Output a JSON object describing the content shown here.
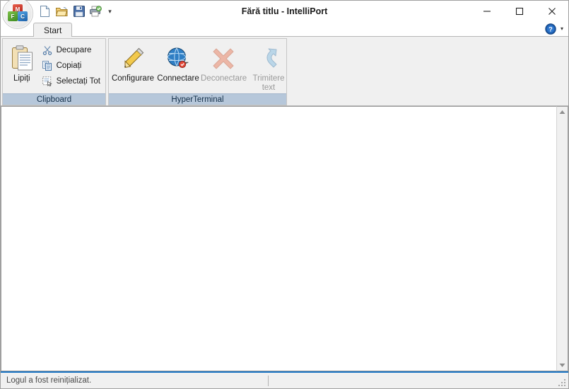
{
  "window": {
    "title": "Fără titlu - IntelliPort",
    "app_icon": "mfc-logo-icon",
    "cube_m": "M",
    "cube_f": "F",
    "cube_c": "C",
    "minimize_label": "—",
    "maximize_label": "▫",
    "close_label": "✕"
  },
  "quick_access": {
    "items": [
      {
        "name": "new-document-icon",
        "tooltip": "New"
      },
      {
        "name": "open-folder-icon",
        "tooltip": "Open"
      },
      {
        "name": "save-icon",
        "tooltip": "Save"
      },
      {
        "name": "print-icon",
        "tooltip": "Print"
      }
    ],
    "more_caret": "▾"
  },
  "ribbon": {
    "tabs": [
      {
        "label": "Start",
        "selected": true
      }
    ],
    "help": {
      "icon": "help-circle-icon",
      "glyph": "?",
      "caret": "▾"
    },
    "groups": [
      {
        "caption": "Clipboard",
        "big_button": {
          "label": "Lipiți",
          "icon": "paste-icon",
          "enabled": true
        },
        "small_buttons": [
          {
            "label": "Decupare",
            "icon": "cut-scissors-icon",
            "enabled": true
          },
          {
            "label": "Copiați",
            "icon": "copy-icon",
            "enabled": true
          },
          {
            "label": "Selectați Tot",
            "icon": "select-all-icon",
            "enabled": true
          }
        ]
      },
      {
        "caption": "HyperTerminal",
        "buttons": [
          {
            "label": "Configurare",
            "icon": "pencil-icon",
            "enabled": true
          },
          {
            "label": "Connectare",
            "icon": "globe-connect-icon",
            "enabled": true
          },
          {
            "label": "Deconectare",
            "icon": "red-x-icon",
            "enabled": false
          },
          {
            "label": "Trimitere text",
            "icon": "send-arrow-icon",
            "enabled": false
          }
        ]
      }
    ]
  },
  "terminal": {
    "content": "",
    "caret_visible": true,
    "scrollbar": {
      "up_arrow": "▲",
      "down_arrow": "▼"
    }
  },
  "statusbar": {
    "message": "Logul a fost reinițializat.",
    "second_pane": ""
  },
  "colors": {
    "accent_blue": "#1a74c4",
    "group_caption_bg": "#b6c7da",
    "ribbon_bg": "#f0f0f0",
    "terminal_bg": "#ffffff",
    "disabled_text": "#9a9a9a"
  }
}
